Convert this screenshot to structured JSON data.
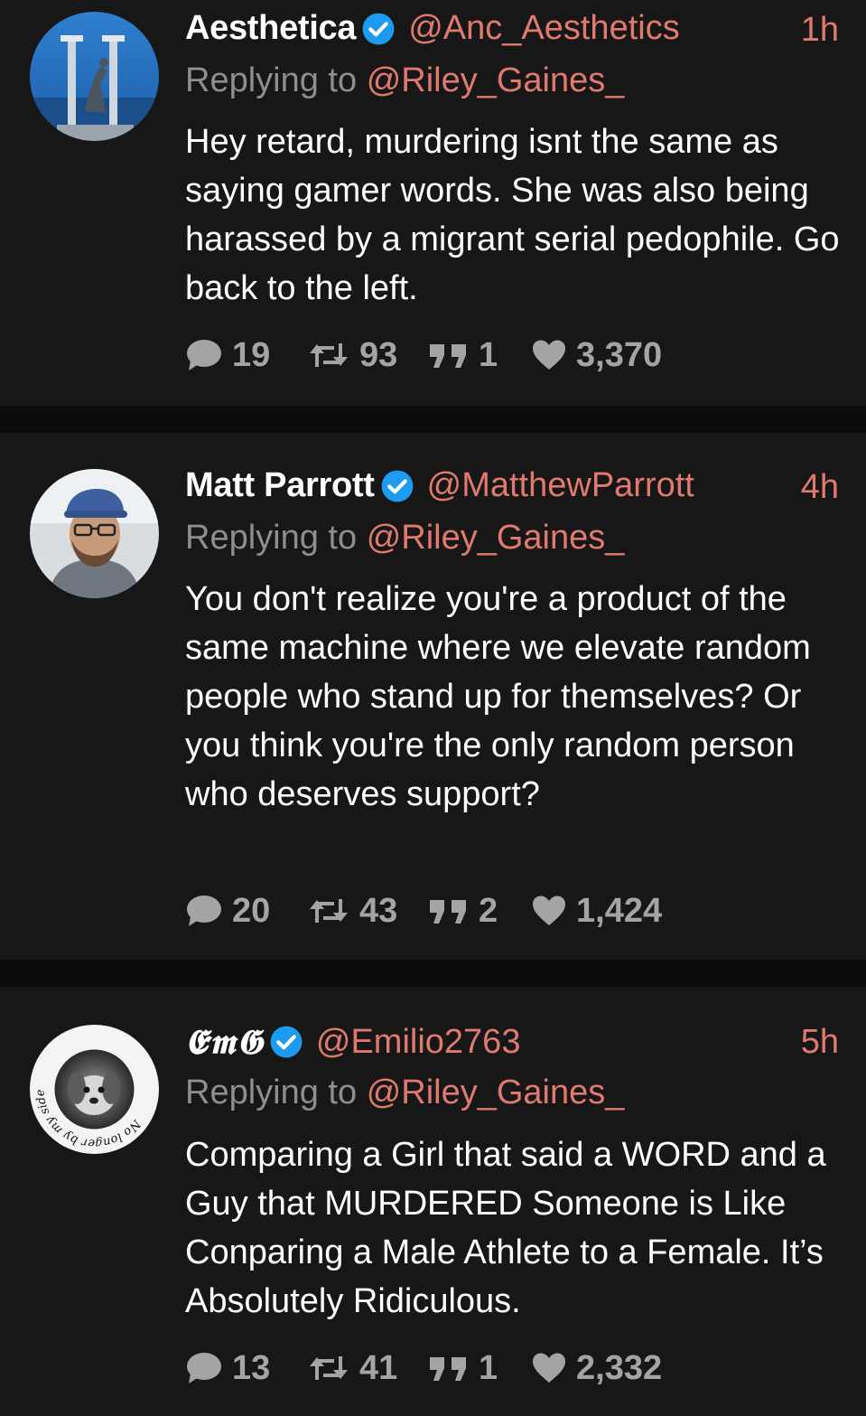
{
  "colors": {
    "background": "#0c0c0c",
    "card": "#171717",
    "accent_handle": "#e07a6e",
    "muted": "#8e8e8e",
    "action_gray": "#a4a4a4",
    "verified_blue": "#1d9bf0"
  },
  "tweets": [
    {
      "author_name": "Aesthetica",
      "verified": true,
      "handle": "@Anc_Aesthetics",
      "time": "1h",
      "reply_prefix": "Replying to",
      "reply_to": "@Riley_Gaines_",
      "text": "Hey retard, murdering isnt the same as saying gamer words. She was also being harassed by a migrant serial pedophile. Go back to the left.",
      "replies": "19",
      "retweets": "93",
      "quotes": "1",
      "likes": "3,370",
      "avatar": "statue-sky-avatar"
    },
    {
      "author_name": "Matt Parrott",
      "verified": true,
      "handle": "@MatthewParrott",
      "time": "4h",
      "reply_prefix": "Replying to",
      "reply_to": "@Riley_Gaines_",
      "text": "You don't realize you're a product of the same machine where we elevate random people who stand up for themselves? Or you think you're the only random person who deserves support?",
      "replies": "20",
      "retweets": "43",
      "quotes": "2",
      "likes": "1,424",
      "avatar": "man-with-cap-avatar"
    },
    {
      "author_name": "𝕰𝖒𝕲",
      "verified": true,
      "handle": "@Emilio2763",
      "time": "5h",
      "reply_prefix": "Replying to",
      "reply_to": "@Riley_Gaines_",
      "text": "Comparing a Girl that said a WORD and a Guy that MURDERED Someone is Like Conparing a Male Athlete to a Female. It’s Absolutely Ridiculous.",
      "replies": "13",
      "retweets": "41",
      "quotes": "1",
      "likes": "2,332",
      "avatar": "memorial-dog-avatar",
      "avatar_ring_text": "No longer by my side, but forever in my heart."
    }
  ]
}
